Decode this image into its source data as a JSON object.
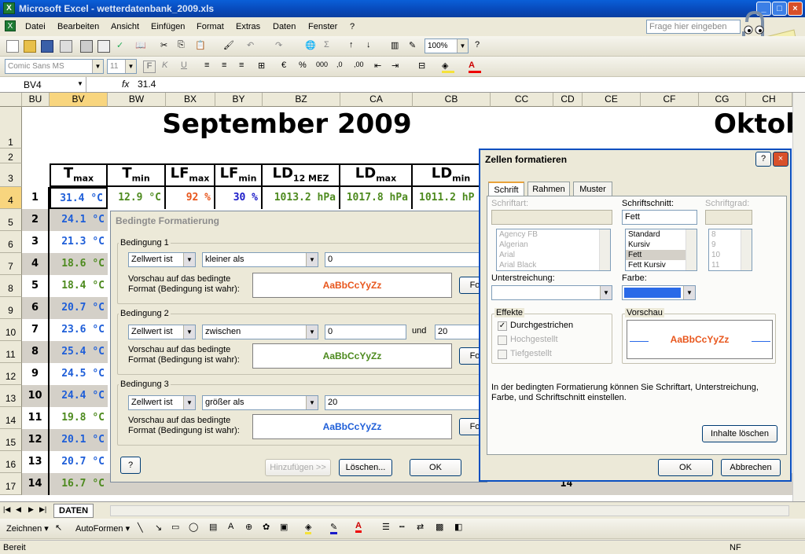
{
  "window": {
    "title": "Microsoft Excel - wetterdatenbank_2009.xls",
    "app_icon": "excel-icon"
  },
  "menu": {
    "items": [
      "Datei",
      "Bearbeiten",
      "Ansicht",
      "Einfügen",
      "Format",
      "Extras",
      "Daten",
      "Fenster",
      "?"
    ],
    "help_placeholder": "Frage hier eingeben"
  },
  "toolbar": {
    "zoom": "100%",
    "font": "Comic Sans MS",
    "size": "11"
  },
  "formula": {
    "name_box": "BV4",
    "fx": "fx",
    "value": "31.4"
  },
  "columns": [
    "BU",
    "BV",
    "BW",
    "BX",
    "BY",
    "BZ",
    "CA",
    "CB",
    "CC",
    "CD",
    "CE",
    "CF",
    "CG",
    "CH"
  ],
  "rows": [
    "1",
    "2",
    "3",
    "4",
    "5",
    "6",
    "7",
    "8",
    "9",
    "10",
    "11",
    "12",
    "13",
    "14",
    "15",
    "16",
    "17"
  ],
  "sheet": {
    "month_title": "September 2009",
    "next_month": "Oktob",
    "headers": [
      {
        "main": "T",
        "sub": "max"
      },
      {
        "main": "T",
        "sub": "min"
      },
      {
        "main": "LF",
        "sub": "max"
      },
      {
        "main": "LF",
        "sub": "min"
      },
      {
        "main": "LD",
        "sub": "12 MEZ"
      },
      {
        "main": "LD",
        "sub": "max"
      },
      {
        "main": "LD",
        "sub": "min"
      }
    ],
    "days": [
      "1",
      "2",
      "3",
      "4",
      "5",
      "6",
      "7",
      "8",
      "9",
      "10",
      "11",
      "12",
      "13",
      "14"
    ],
    "tmax": [
      "31.4 °C",
      "24.1 °C",
      "21.3 °C",
      "18.6 °C",
      "18.4 °C",
      "20.7 °C",
      "23.6 °C",
      "25.4 °C",
      "24.5 °C",
      "24.4 °C",
      "19.8 °C",
      "20.1 °C",
      "20.7 °C",
      "16.7 °C"
    ],
    "row1": {
      "tmin": "12.9 °C",
      "lfmax": "92 %",
      "lfmin": "30 %",
      "ld12": "1013.2 hPa",
      "ldmax": "1017.8 hPa",
      "ldmin": "1011.2 hP"
    },
    "row17_fragment": {
      "cd": "14"
    }
  },
  "cond_dialog": {
    "title": "Bedingte Formatierung",
    "conditions": [
      {
        "label": "Bedingung 1",
        "type": "Zellwert ist",
        "op": "kleiner als",
        "v1": "0",
        "v2": "",
        "preview": "AaBbCcYyZz",
        "color": "#e8561c"
      },
      {
        "label": "Bedingung 2",
        "type": "Zellwert ist",
        "op": "zwischen",
        "v1": "0",
        "and": "und",
        "v2": "20",
        "preview": "AaBbCcYyZz",
        "color": "#4d8a1e"
      },
      {
        "label": "Bedingung 3",
        "type": "Zellwert ist",
        "op": "größer als",
        "v1": "20",
        "v2": "",
        "preview": "AaBbCcYyZz",
        "color": "#1e5ed8"
      }
    ],
    "preview_label": "Vorschau auf das bedingte Format (Bedingung ist wahr):",
    "format_btn": "Fo",
    "add_btn": "Hinzufügen >>",
    "delete_btn": "Löschen...",
    "ok_btn": "OK"
  },
  "fmt_dialog": {
    "title": "Zellen formatieren",
    "tabs": [
      "Schrift",
      "Rahmen",
      "Muster"
    ],
    "font_label": "Schriftart:",
    "style_label": "Schriftschnitt:",
    "size_label": "Schriftgrad:",
    "style_value": "Fett",
    "fonts": [
      "Agency FB",
      "Algerian",
      "Arial",
      "Arial Black"
    ],
    "styles": [
      "Standard",
      "Kursiv",
      "Fett",
      "Fett Kursiv"
    ],
    "sizes": [
      "8",
      "9",
      "10",
      "11"
    ],
    "underline_label": "Unterstreichung:",
    "color_label": "Farbe:",
    "color_value": "#2a6ae8",
    "effects_label": "Effekte",
    "effects": [
      "Durchgestrichen",
      "Hochgestellt",
      "Tiefgestellt"
    ],
    "preview_label": "Vorschau",
    "preview_text": "AaBbCcYyZz",
    "info": "In der bedingten Formatierung können Sie Schriftart, Unterstreichung, Farbe, und Schriftschnitt einstellen.",
    "clear_btn": "Inhalte löschen",
    "ok_btn": "OK",
    "cancel_btn": "Abbrechen"
  },
  "sheet_tab": "DATEN",
  "drawing": {
    "draw": "Zeichnen ▾",
    "autoshapes": "AutoFormen ▾"
  },
  "status": {
    "left": "Bereit",
    "right": "NF"
  }
}
